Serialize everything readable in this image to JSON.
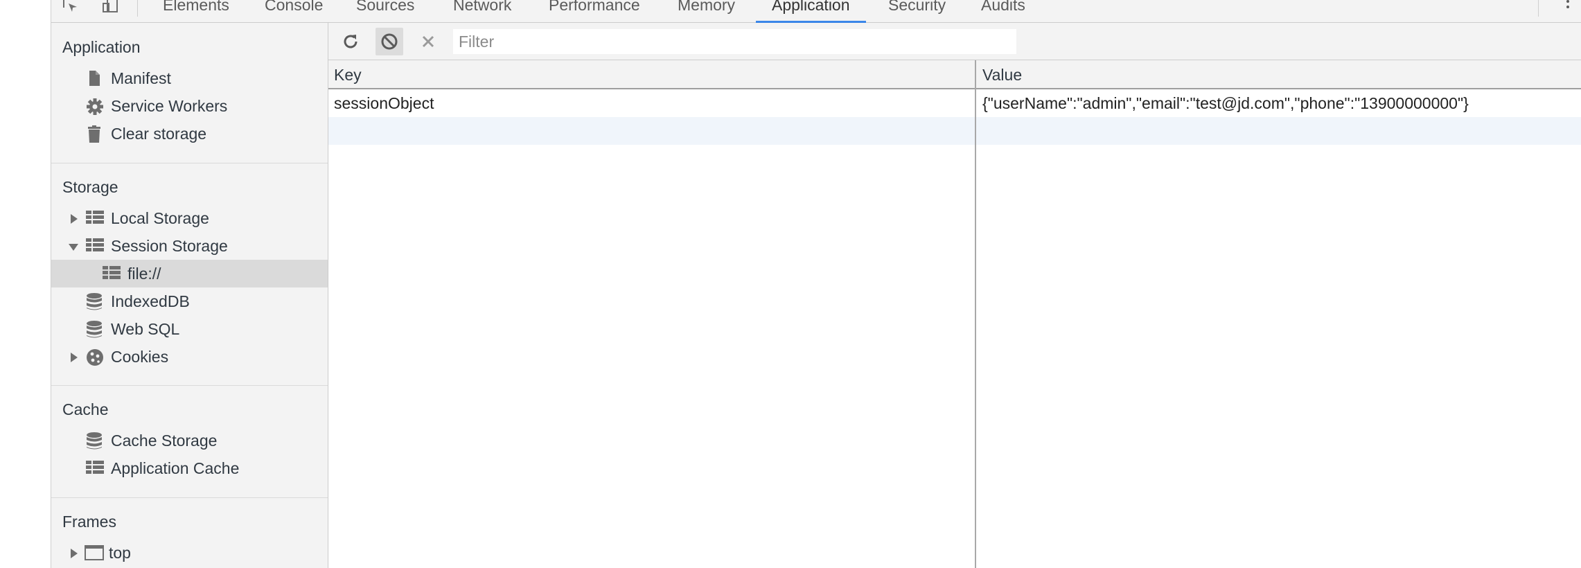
{
  "tabs": [
    {
      "label": "Elements",
      "active": false
    },
    {
      "label": "Console",
      "active": false
    },
    {
      "label": "Sources",
      "active": false
    },
    {
      "label": "Network",
      "active": false
    },
    {
      "label": "Performance",
      "active": false
    },
    {
      "label": "Memory",
      "active": false
    },
    {
      "label": "Application",
      "active": true
    },
    {
      "label": "Security",
      "active": false
    },
    {
      "label": "Audits",
      "active": false
    }
  ],
  "sidebar": {
    "application": {
      "title": "Application",
      "items": [
        {
          "label": "Manifest",
          "icon": "document-icon"
        },
        {
          "label": "Service Workers",
          "icon": "gear-icon"
        },
        {
          "label": "Clear storage",
          "icon": "trash-icon"
        }
      ]
    },
    "storage": {
      "title": "Storage",
      "items": [
        {
          "label": "Local Storage",
          "icon": "table-icon",
          "expanded": false
        },
        {
          "label": "Session Storage",
          "icon": "table-icon",
          "expanded": true
        },
        {
          "label": "file://",
          "icon": "table-icon",
          "selected": true
        },
        {
          "label": "IndexedDB",
          "icon": "database-icon"
        },
        {
          "label": "Web SQL",
          "icon": "database-icon"
        },
        {
          "label": "Cookies",
          "icon": "cookie-icon",
          "expanded": false
        }
      ]
    },
    "cache": {
      "title": "Cache",
      "items": [
        {
          "label": "Cache Storage",
          "icon": "database-icon"
        },
        {
          "label": "Application Cache",
          "icon": "table-icon"
        }
      ]
    },
    "frames": {
      "title": "Frames",
      "items": [
        {
          "label": "top",
          "icon": "frame-icon",
          "expanded": false
        }
      ]
    }
  },
  "toolbar": {
    "filter_placeholder": "Filter",
    "filter_value": ""
  },
  "grid": {
    "columns": [
      "Key",
      "Value"
    ],
    "rows": [
      {
        "key": "sessionObject",
        "value": "{\"userName\":\"admin\",\"email\":\"test@jd.com\",\"phone\":\"13900000000\"}"
      }
    ]
  },
  "colors": {
    "active_tab_underline": "#1a73e8",
    "selected_item_bg": "#dadada",
    "panel_bg": "#f3f3f3"
  }
}
